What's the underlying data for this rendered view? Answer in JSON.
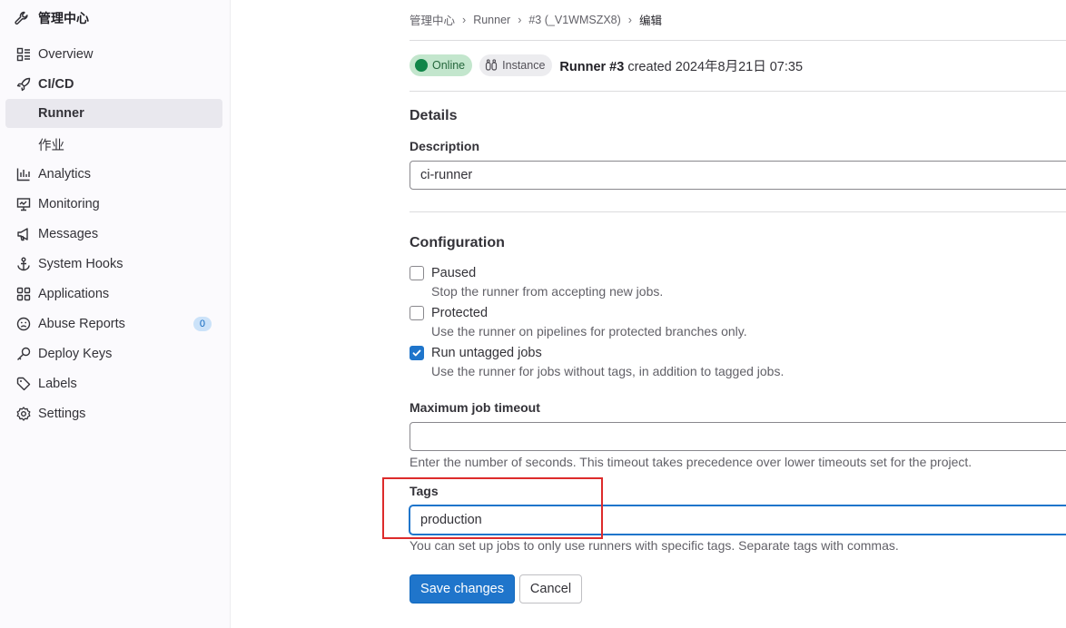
{
  "sidebar": {
    "title": "管理中心",
    "items": [
      {
        "label": "Overview",
        "icon": "overview-icon"
      },
      {
        "label": "CI/CD",
        "icon": "rocket-icon"
      },
      {
        "label": "Runner"
      },
      {
        "label": "作业"
      },
      {
        "label": "Analytics",
        "icon": "chart-icon"
      },
      {
        "label": "Monitoring",
        "icon": "monitor-icon"
      },
      {
        "label": "Messages",
        "icon": "bullhorn-icon"
      },
      {
        "label": "System Hooks",
        "icon": "anchor-icon"
      },
      {
        "label": "Applications",
        "icon": "applications-icon"
      },
      {
        "label": "Abuse Reports",
        "icon": "abuse-icon",
        "badge": "0"
      },
      {
        "label": "Deploy Keys",
        "icon": "key-icon"
      },
      {
        "label": "Labels",
        "icon": "label-icon"
      },
      {
        "label": "Settings",
        "icon": "settings-icon"
      }
    ]
  },
  "breadcrumb": [
    "管理中心",
    "Runner",
    "#3 (_V1WMSZX8)",
    "编辑"
  ],
  "status": {
    "online": "Online",
    "instance": "Instance",
    "runner_name": "Runner #3",
    "created_text": " created 2024年8月21日 07:35"
  },
  "details": {
    "heading": "Details",
    "description_label": "Description",
    "description_value": "ci-runner"
  },
  "configuration": {
    "heading": "Configuration",
    "paused_label": "Paused",
    "paused_help": "Stop the runner from accepting new jobs.",
    "protected_label": "Protected",
    "protected_help": "Use the runner on pipelines for protected branches only.",
    "untagged_label": "Run untagged jobs",
    "untagged_help": "Use the runner for jobs without tags, in addition to tagged jobs.",
    "timeout_label": "Maximum job timeout",
    "timeout_value": "",
    "timeout_help": "Enter the number of seconds. This timeout takes precedence over lower timeouts set for the project.",
    "tags_label": "Tags",
    "tags_value": "production",
    "tags_help": "You can set up jobs to only use runners with specific tags. Separate tags with commas."
  },
  "buttons": {
    "save": "Save changes",
    "cancel": "Cancel"
  },
  "colors": {
    "primary": "#1f75cb",
    "online_bg": "#c3e6cd",
    "highlight": "#dd2b2b"
  }
}
